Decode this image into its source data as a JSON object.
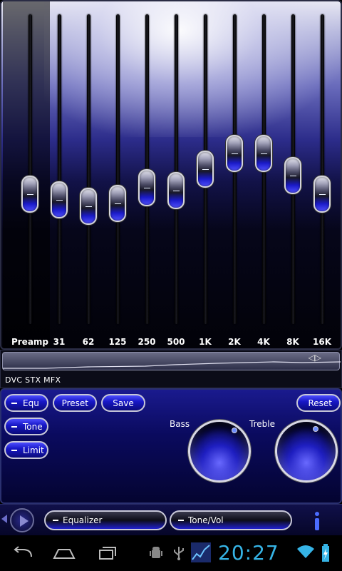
{
  "equalizer": {
    "bands": [
      {
        "label": "Preamp",
        "level": 0.42
      },
      {
        "label": "31",
        "level": 0.4
      },
      {
        "label": "62",
        "level": 0.38
      },
      {
        "label": "125",
        "level": 0.39
      },
      {
        "label": "250",
        "level": 0.44
      },
      {
        "label": "500",
        "level": 0.43
      },
      {
        "label": "1K",
        "level": 0.5
      },
      {
        "label": "2K",
        "level": 0.55
      },
      {
        "label": "4K",
        "level": 0.55
      },
      {
        "label": "8K",
        "level": 0.48
      },
      {
        "label": "16K",
        "level": 0.42
      }
    ]
  },
  "visualizer": {
    "label": "DVC STX MFX",
    "arrows": "◁▷"
  },
  "controls": {
    "equ_label": "Equ",
    "tone_label": "Tone",
    "limit_label": "Limit",
    "preset_label": "Preset",
    "save_label": "Save",
    "reset_label": "Reset",
    "bass_label": "Bass",
    "treble_label": "Treble"
  },
  "tabs": {
    "equalizer_label": "Equalizer",
    "tone_vol_label": "Tone/Vol"
  },
  "status_bar": {
    "time": "20:27"
  },
  "colors": {
    "accent": "#1a1ad0",
    "clock": "#36b4e6"
  }
}
